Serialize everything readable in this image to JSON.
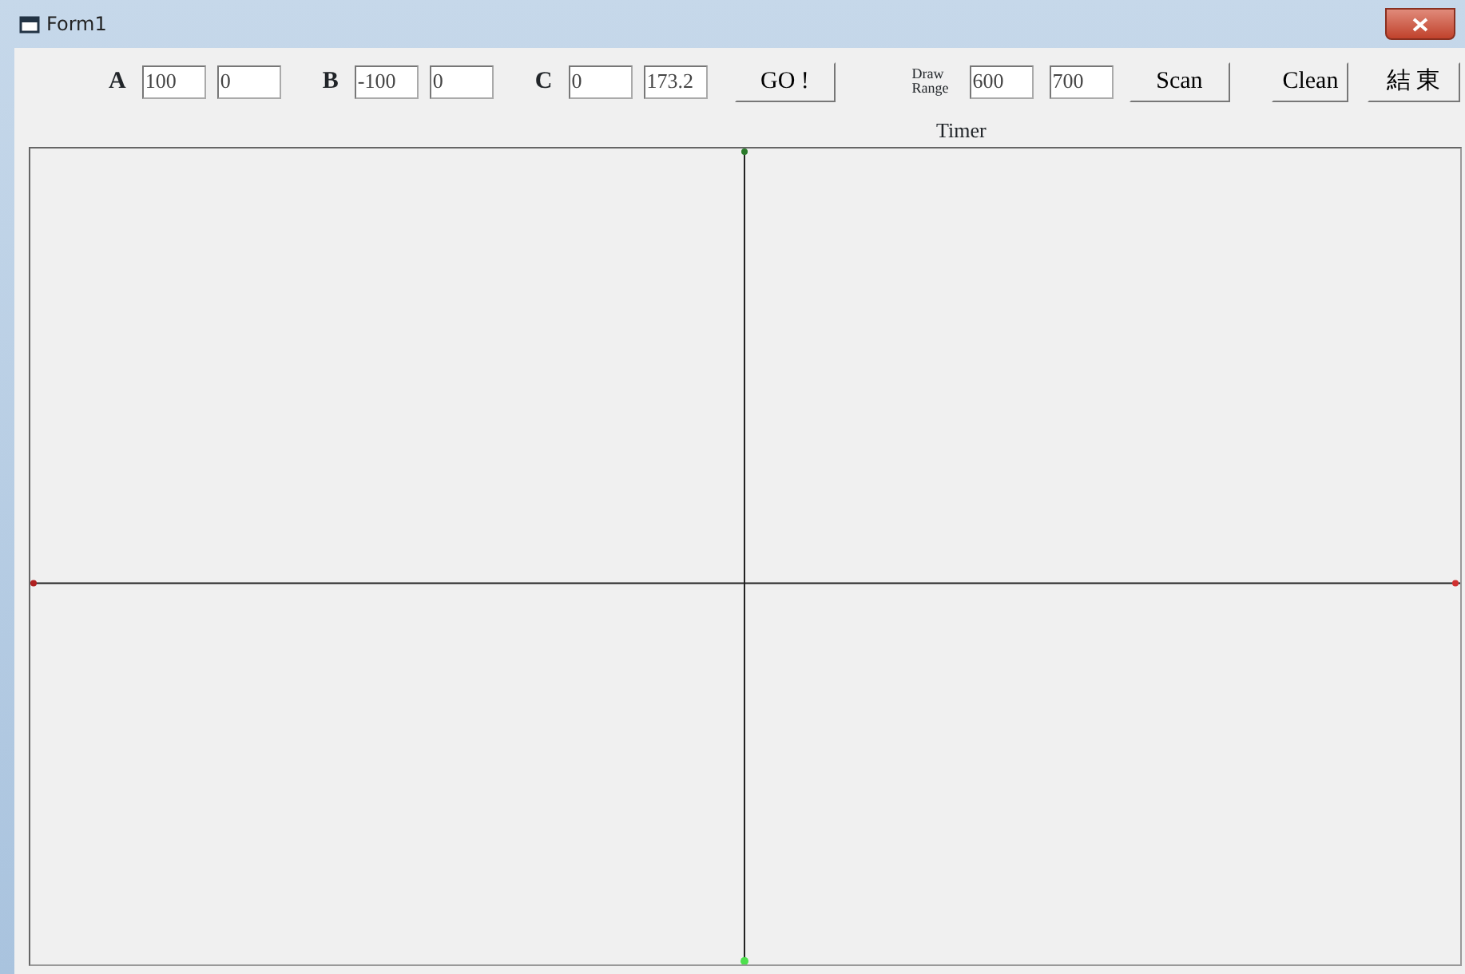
{
  "window": {
    "title": "Form1"
  },
  "points": [
    {
      "label": "A",
      "values": [
        "100",
        "0"
      ]
    },
    {
      "label": "B",
      "values": [
        "-100",
        "0"
      ]
    },
    {
      "label": "C",
      "values": [
        "0",
        "173.2"
      ]
    }
  ],
  "go_button": "GO !",
  "draw_range": {
    "label": "Draw Range",
    "values": [
      "600",
      "700"
    ]
  },
  "buttons": [
    "Scan",
    "Clean",
    "結 東"
  ],
  "timer_label": "Timer"
}
